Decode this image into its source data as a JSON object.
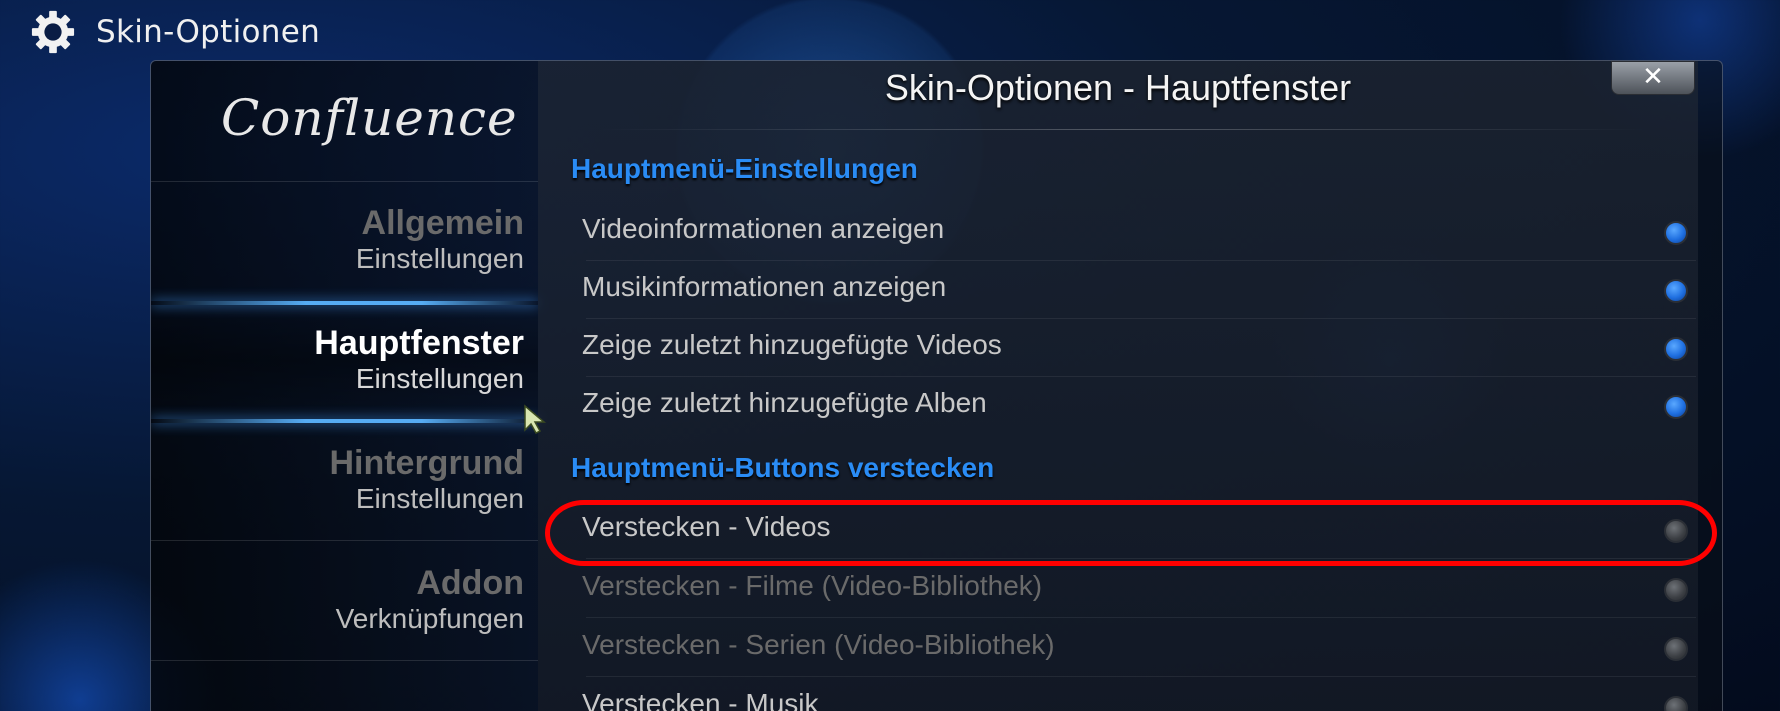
{
  "topbar": {
    "title": "Skin-Optionen",
    "icon": "gear-icon"
  },
  "logo": {
    "text": "Confluence"
  },
  "sidebar": {
    "items": [
      {
        "title": "Allgemein",
        "subtitle": "Einstellungen",
        "active": false
      },
      {
        "title": "Hauptfenster",
        "subtitle": "Einstellungen",
        "active": true
      },
      {
        "title": "Hintergrund",
        "subtitle": "Einstellungen",
        "active": false
      },
      {
        "title": "Addon",
        "subtitle": "Verknüpfungen",
        "active": false
      }
    ]
  },
  "main": {
    "title": "Skin-Optionen - Hauptfenster",
    "close_label": "✕",
    "sections": [
      {
        "heading": "Hauptmenü-Einstellungen",
        "rows": [
          {
            "label": "Videoinformationen anzeigen",
            "state": "on",
            "enabled": true
          },
          {
            "label": "Musikinformationen anzeigen",
            "state": "on",
            "enabled": true
          },
          {
            "label": "Zeige zuletzt hinzugefügte Videos",
            "state": "on",
            "enabled": true
          },
          {
            "label": "Zeige zuletzt hinzugefügte Alben",
            "state": "on",
            "enabled": true
          }
        ]
      },
      {
        "heading": "Hauptmenü-Buttons verstecken",
        "rows": [
          {
            "label": "Verstecken - Videos",
            "state": "off",
            "enabled": true
          },
          {
            "label": "Verstecken - Filme  (Video-Bibliothek)",
            "state": "off",
            "enabled": false
          },
          {
            "label": "Verstecken - Serien  (Video-Bibliothek)",
            "state": "off",
            "enabled": false
          },
          {
            "label": "Verstecken - Musik",
            "state": "off",
            "enabled": true
          }
        ]
      }
    ]
  },
  "colors": {
    "accent": "#2a8cf5",
    "annotation": "#ff0000",
    "toggle_on": "#1f6fe0",
    "toggle_off": "#3c3f44"
  }
}
